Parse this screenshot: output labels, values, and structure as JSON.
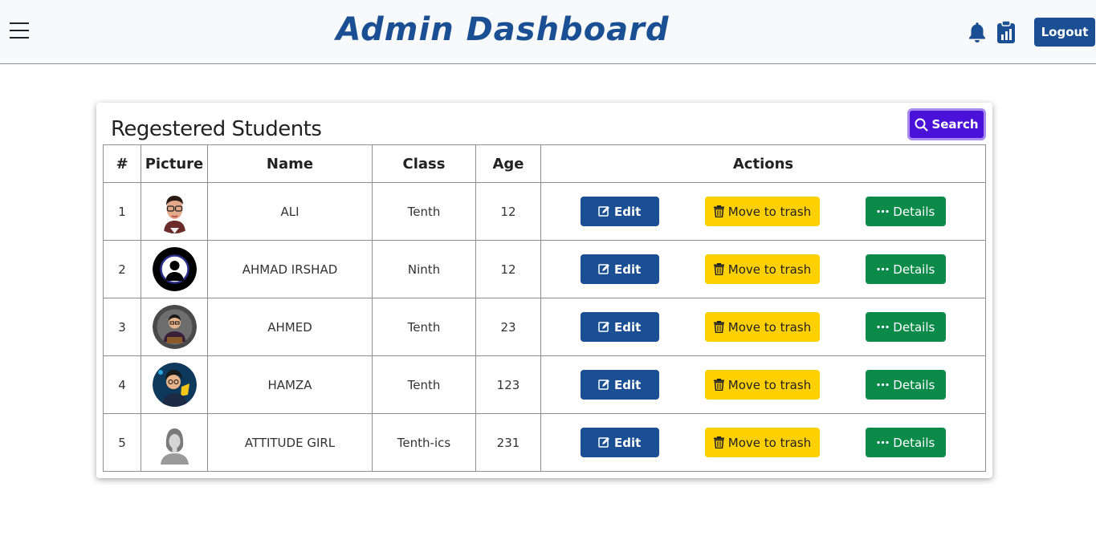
{
  "header": {
    "title": "Admin Dashboard",
    "logout_label": "Logout"
  },
  "card": {
    "title": "Regestered Students",
    "search_label": "Search"
  },
  "table": {
    "columns": [
      "#",
      "Picture",
      "Name",
      "Class",
      "Age",
      "Actions"
    ],
    "rows": [
      {
        "num": "1",
        "name": "ALI",
        "class": "Tenth",
        "age": "12"
      },
      {
        "num": "2",
        "name": "AHMAD IRSHAD",
        "class": "Ninth",
        "age": "12"
      },
      {
        "num": "3",
        "name": "AHMED",
        "class": "Tenth",
        "age": "23"
      },
      {
        "num": "4",
        "name": "HAMZA",
        "class": "Tenth",
        "age": "123"
      },
      {
        "num": "5",
        "name": "ATTITUDE GIRL",
        "class": "Tenth-ics",
        "age": "231"
      }
    ],
    "actions": {
      "edit_label": "Edit",
      "trash_label": "Move to trash",
      "details_label": "Details"
    }
  },
  "colors": {
    "brand": "#1b4f93",
    "search": "#4a12d9",
    "trash": "#ffd000",
    "details": "#0b8a4a"
  },
  "icons": [
    "menu-icon",
    "bell-icon",
    "clipboard-chart-icon",
    "search-icon",
    "edit-icon",
    "trash-icon",
    "dots-icon"
  ]
}
